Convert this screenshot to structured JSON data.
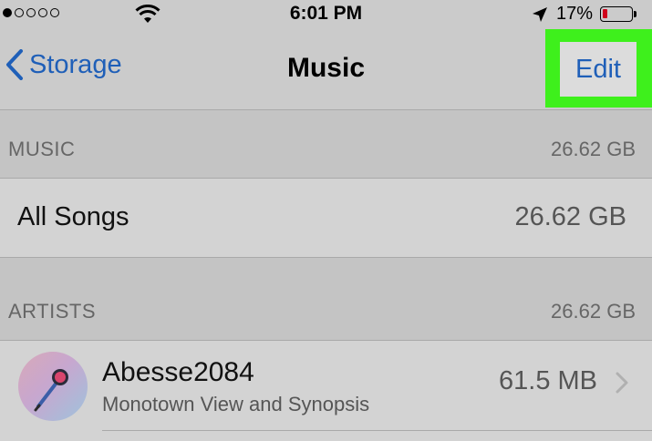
{
  "status_bar": {
    "signal_dots": [
      true,
      false,
      false,
      false,
      false
    ],
    "time": "6:01 PM",
    "battery_percent": "17%",
    "battery_level": 0.17,
    "battery_color": "#d0021b"
  },
  "nav": {
    "back_label": "Storage",
    "title": "Music",
    "edit_label": "Edit",
    "accent_color": "#1f5fb8",
    "highlight_color": "#3ef01c"
  },
  "sections": {
    "music": {
      "header": "MUSIC",
      "size": "26.62 GB",
      "all_songs": {
        "label": "All Songs",
        "size": "26.62 GB"
      }
    },
    "artists": {
      "header": "ARTISTS",
      "size": "26.62 GB",
      "items": [
        {
          "name": "Abesse2084",
          "subtitle": "Monotown View and Synopsis",
          "size": "61.5 MB",
          "icon": "microphone-icon"
        }
      ]
    }
  }
}
